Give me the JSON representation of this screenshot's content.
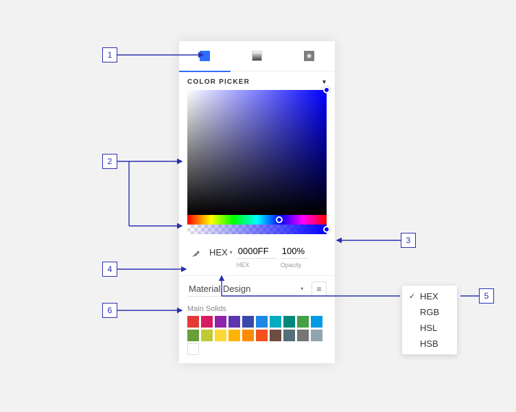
{
  "annotations": {
    "a1": "1",
    "a2": "2",
    "a3": "3",
    "a4": "4",
    "a5": "5",
    "a6": "6"
  },
  "picker": {
    "section_title": "COLOR PICKER",
    "format_selected": "HEX",
    "hex_value": "0000FF",
    "hex_label": "HEX",
    "opacity_value": "100%",
    "opacity_label": "Opacity"
  },
  "palette_section": {
    "selected_palette": "Material Design",
    "swatch_group_title": "Main Solids",
    "swatches": [
      "#e53935",
      "#d81b60",
      "#8e24aa",
      "#5e35b1",
      "#3949ab",
      "#1e88e5",
      "#00acc1",
      "#00897b",
      "#43a047",
      "#039be5",
      "#689f38",
      "#c0ca33",
      "#fdd835",
      "#ffb300",
      "#fb8c00",
      "#f4511e",
      "#6d4c41",
      "#546e7a",
      "#757575",
      "#90a4ae"
    ]
  },
  "format_menu": {
    "checkmark": "✓",
    "items": [
      "HEX",
      "RGB",
      "HSL",
      "HSB"
    ]
  }
}
